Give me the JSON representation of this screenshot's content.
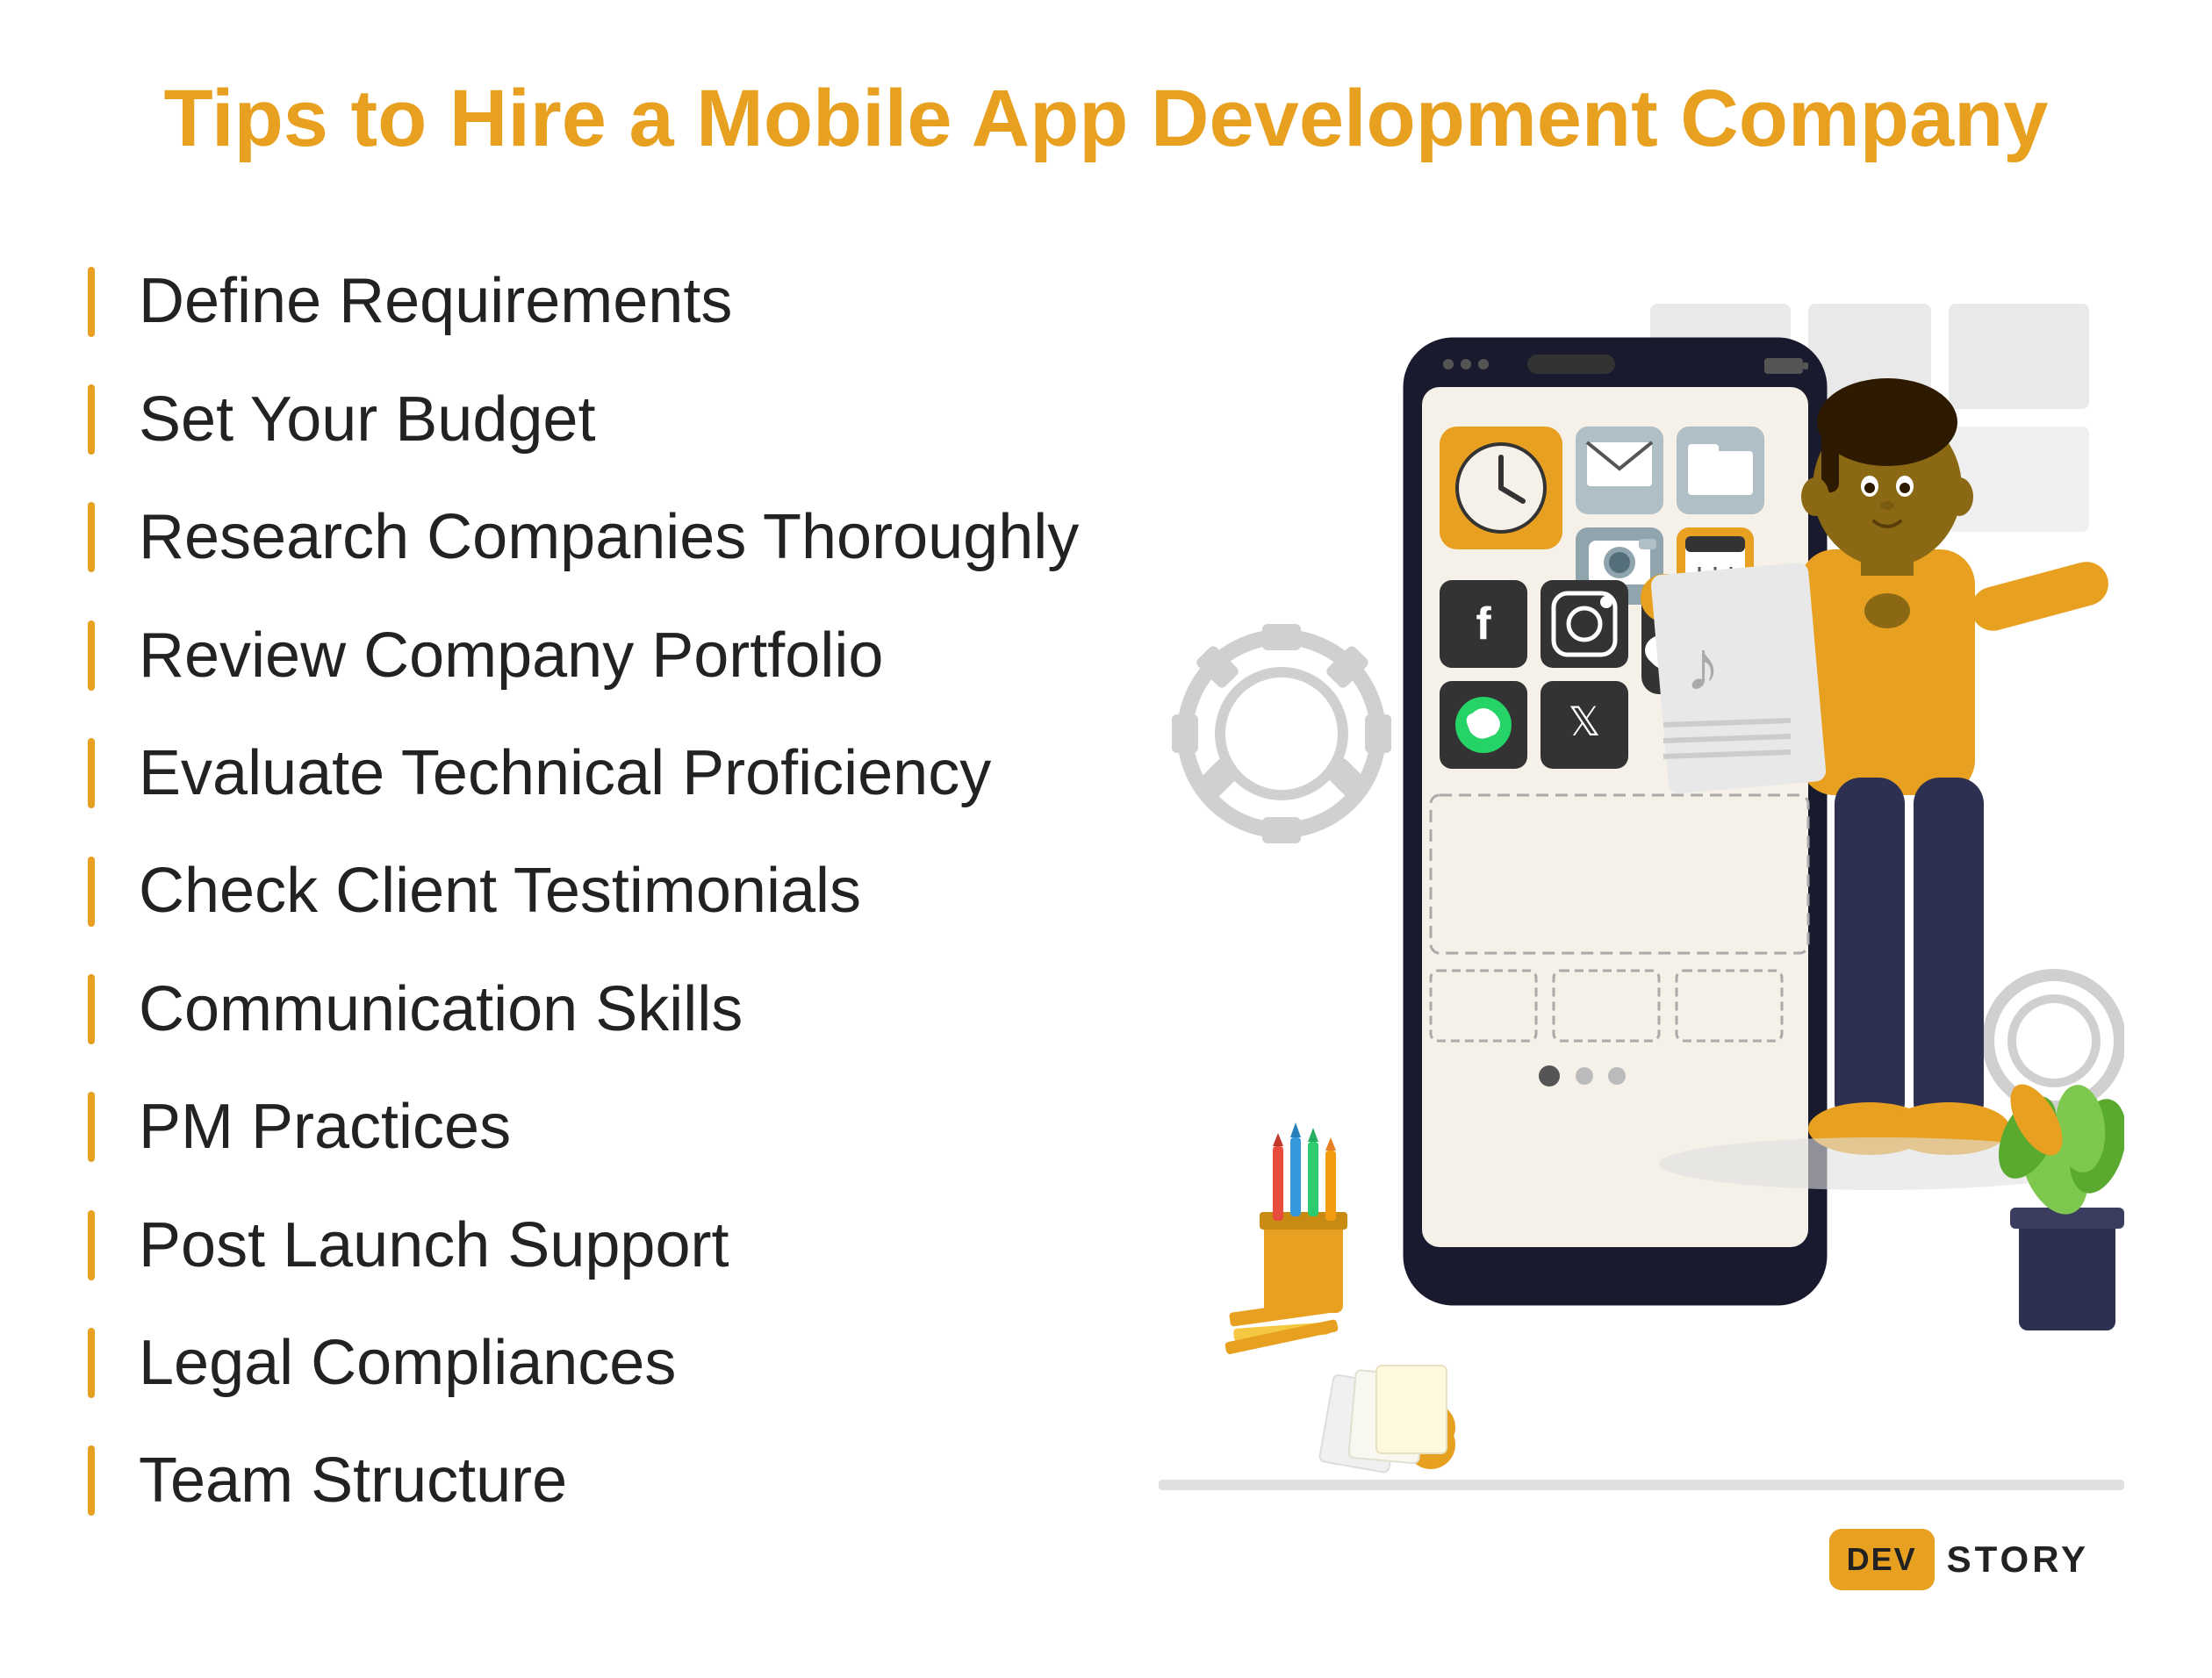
{
  "page": {
    "title": "Tips to Hire a Mobile App Development Company",
    "background_color": "#ffffff"
  },
  "list": {
    "items": [
      {
        "label": "Define Requirements",
        "id": "define-requirements"
      },
      {
        "label": "Set Your Budget",
        "id": "set-budget"
      },
      {
        "label": "Research Companies Thoroughly",
        "id": "research-companies"
      },
      {
        "label": "Review Company Portfolio",
        "id": "review-portfolio"
      },
      {
        "label": "Evaluate Technical Proficiency",
        "id": "evaluate-technical"
      },
      {
        "label": "Check Client Testimonials",
        "id": "check-testimonials"
      },
      {
        "label": "Communication Skills",
        "id": "communication-skills"
      },
      {
        "label": "PM Practices",
        "id": "pm-practices"
      },
      {
        "label": "Post Launch Support",
        "id": "post-launch"
      },
      {
        "label": "Legal Compliances",
        "id": "legal-compliances"
      },
      {
        "label": "Team Structure",
        "id": "team-structure"
      }
    ]
  },
  "brand": {
    "box_text": "DEV",
    "word": "STORY"
  },
  "colors": {
    "accent": "#E8A020",
    "text_dark": "#222222",
    "text_medium": "#444444",
    "border_color": "#E8A020"
  }
}
